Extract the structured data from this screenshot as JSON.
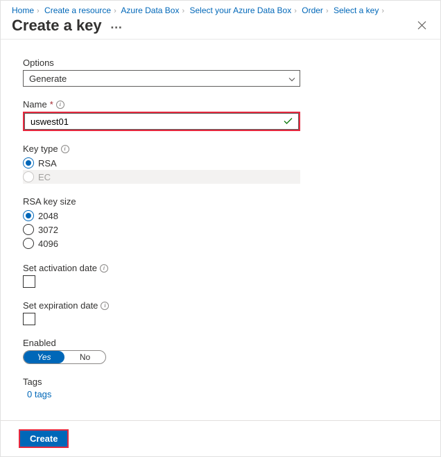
{
  "breadcrumb": [
    "Home",
    "Create a resource",
    "Azure Data Box",
    "Select your Azure Data Box",
    "Order",
    "Select a key"
  ],
  "header": {
    "title": "Create a key"
  },
  "options": {
    "label": "Options",
    "selected": "Generate"
  },
  "name": {
    "label": "Name",
    "value": "uswest01"
  },
  "keytype": {
    "label": "Key type",
    "options": [
      "RSA",
      "EC"
    ],
    "selected": "RSA"
  },
  "keysize": {
    "label": "RSA key size",
    "options": [
      "2048",
      "3072",
      "4096"
    ],
    "selected": "2048"
  },
  "activation": {
    "label": "Set activation date"
  },
  "expiration": {
    "label": "Set expiration date"
  },
  "enabled": {
    "label": "Enabled",
    "yes": "Yes",
    "no": "No"
  },
  "tags": {
    "label": "Tags",
    "link": "0 tags"
  },
  "footer": {
    "create": "Create"
  }
}
